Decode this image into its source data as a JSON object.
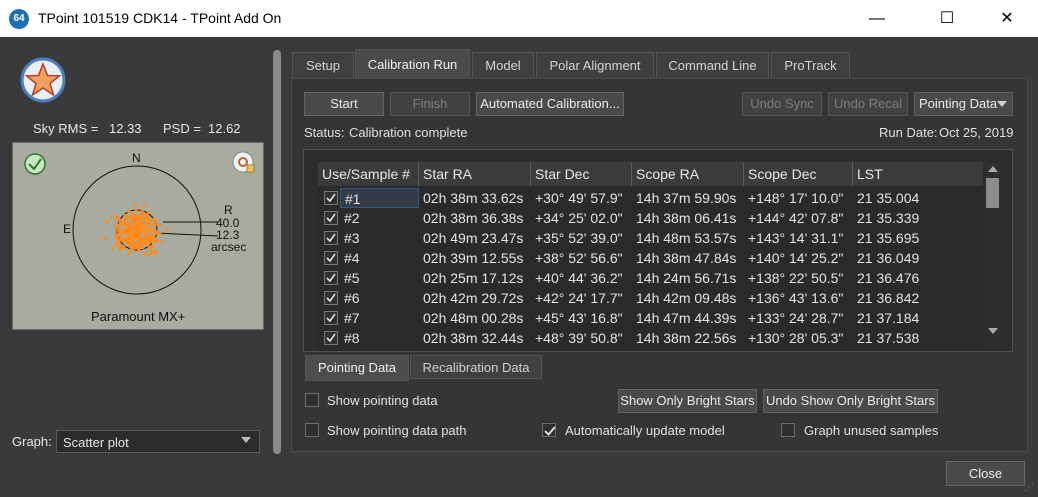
{
  "window": {
    "icon_text": "64",
    "title": "TPoint 101519 CDK14 - TPoint Add On",
    "minimize": "—",
    "maximize": "☐",
    "close": "✕"
  },
  "left": {
    "sky_rms_label": "Sky RMS =",
    "sky_rms_value": "12.33",
    "psd_label": "PSD =",
    "psd_value": "12.62",
    "plot": {
      "north": "N",
      "east": "E",
      "r_label": "R",
      "r_value1": "40.0",
      "r_value2": "12.3",
      "units": "arcsec",
      "mount": "Paramount MX+"
    },
    "graph_label": "Graph:",
    "graph_value": "Scatter plot"
  },
  "tabs": [
    "Setup",
    "Calibration Run",
    "Model",
    "Polar Alignment",
    "Command Line",
    "ProTrack"
  ],
  "active_tab": "Calibration Run",
  "toolbar": {
    "start": "Start",
    "finish": "Finish",
    "automated": "Automated Calibration...",
    "undo_sync": "Undo Sync",
    "undo_recal": "Undo Recal",
    "pointing_data": "Pointing Data"
  },
  "status": {
    "label": "Status:",
    "text": "Calibration complete",
    "run_date_label": "Run Date:",
    "run_date": "Oct 25, 2019"
  },
  "table": {
    "columns": [
      "Use/Sample #",
      "Star RA",
      "Star Dec",
      "Scope RA",
      "Scope Dec",
      "LST"
    ],
    "rows": [
      {
        "sample": "#1",
        "star_ra": "02h 38m 33.62s",
        "star_dec": "+30° 49' 57.9\"",
        "scope_ra": "14h 37m 59.90s",
        "scope_dec": "+148° 17' 10.0\"",
        "lst": "21 35.004"
      },
      {
        "sample": "#2",
        "star_ra": "02h 38m 36.38s",
        "star_dec": "+34° 25' 02.0\"",
        "scope_ra": "14h 38m 06.41s",
        "scope_dec": "+144° 42' 07.8\"",
        "lst": "21 35.339"
      },
      {
        "sample": "#3",
        "star_ra": "02h 49m 23.47s",
        "star_dec": "+35° 52' 39.0\"",
        "scope_ra": "14h 48m 53.57s",
        "scope_dec": "+143° 14' 31.1\"",
        "lst": "21 35.695"
      },
      {
        "sample": "#4",
        "star_ra": "02h 39m 12.55s",
        "star_dec": "+38° 52' 56.6\"",
        "scope_ra": "14h 38m 47.84s",
        "scope_dec": "+140° 14' 25.2\"",
        "lst": "21 36.049"
      },
      {
        "sample": "#5",
        "star_ra": "02h 25m 17.12s",
        "star_dec": "+40° 44' 36.2\"",
        "scope_ra": "14h 24m 56.71s",
        "scope_dec": "+138° 22' 50.5\"",
        "lst": "21 36.476"
      },
      {
        "sample": "#6",
        "star_ra": "02h 42m 29.72s",
        "star_dec": "+42° 24' 17.7\"",
        "scope_ra": "14h 42m 09.48s",
        "scope_dec": "+136° 43' 13.6\"",
        "lst": "21 36.842"
      },
      {
        "sample": "#7",
        "star_ra": "02h 48m 00.28s",
        "star_dec": "+45° 43' 16.8\"",
        "scope_ra": "14h 47m 44.39s",
        "scope_dec": "+133° 24' 28.7\"",
        "lst": "21 37.184"
      },
      {
        "sample": "#8",
        "star_ra": "02h 38m 32.44s",
        "star_dec": "+48° 39' 50.8\"",
        "scope_ra": "14h 38m 22.56s",
        "scope_dec": "+130° 28' 05.3\"",
        "lst": "21 37.538"
      }
    ]
  },
  "subtabs": [
    "Pointing Data",
    "Recalibration Data"
  ],
  "options": {
    "show_pointing_data": "Show pointing data",
    "show_path": "Show pointing data path",
    "bright_stars": "Show Only Bright Stars",
    "undo_bright": "Undo Show Only Bright Stars",
    "auto_update": "Automatically update model",
    "graph_unused": "Graph unused samples"
  },
  "close_label": "Close"
}
